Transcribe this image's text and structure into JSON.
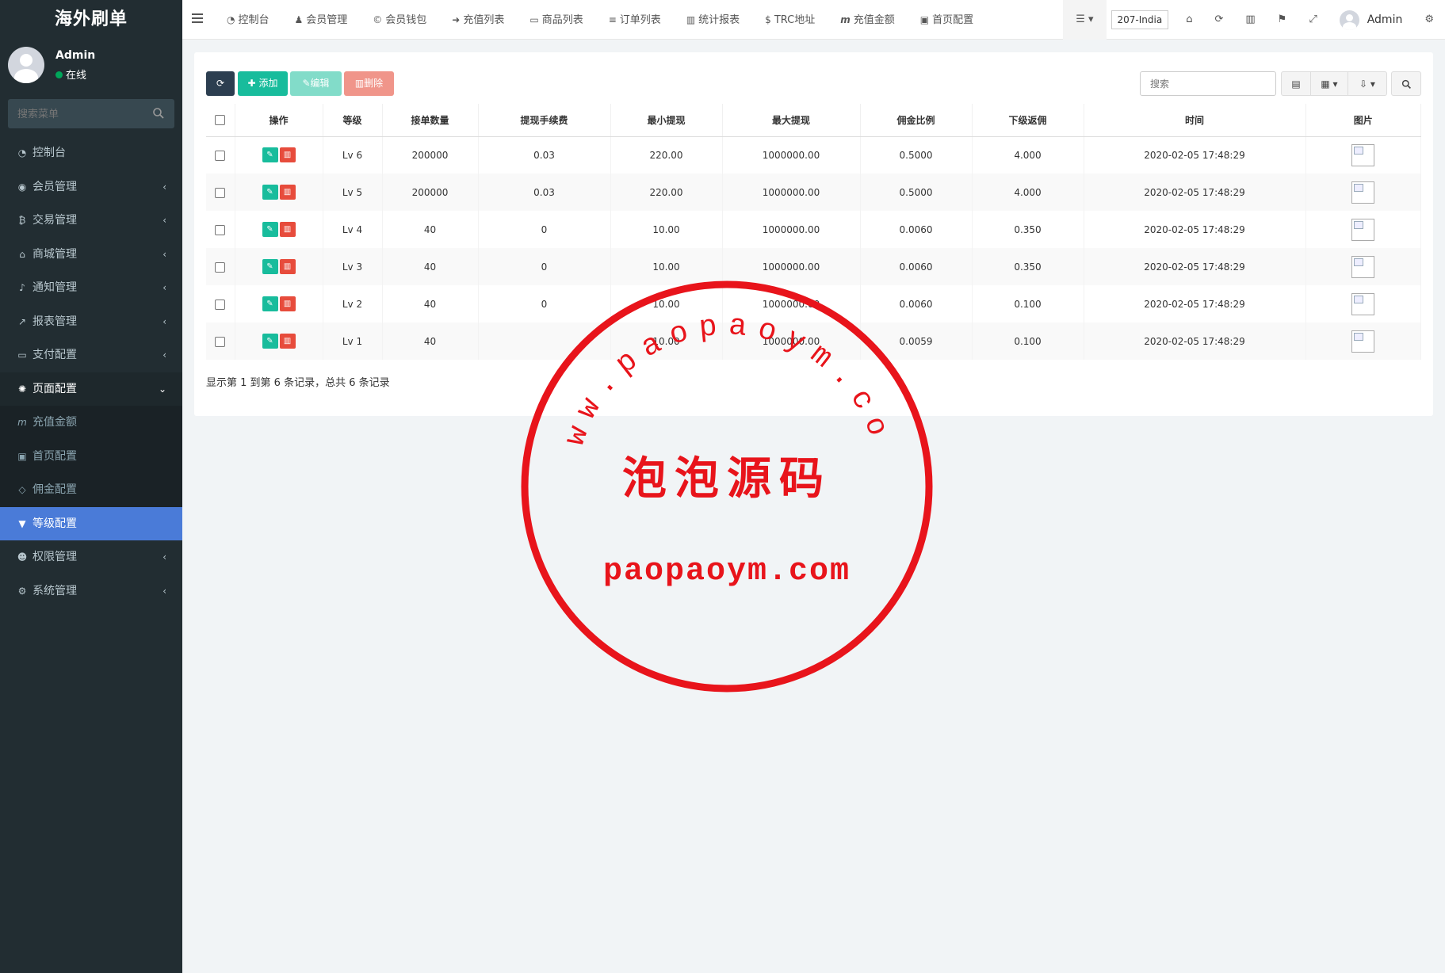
{
  "brand": "海外刷单",
  "user": {
    "name": "Admin",
    "status": "在线"
  },
  "sidebar_search": {
    "placeholder": "搜索菜单"
  },
  "sidebar": {
    "items": [
      {
        "label": "控制台",
        "icon": "dashboard-icon"
      },
      {
        "label": "会员管理",
        "icon": "user-circle-icon"
      },
      {
        "label": "交易管理",
        "icon": "bitcoin-icon"
      },
      {
        "label": "商城管理",
        "icon": "home-icon"
      },
      {
        "label": "通知管理",
        "icon": "bell-icon"
      },
      {
        "label": "报表管理",
        "icon": "line-chart-icon"
      },
      {
        "label": "支付配置",
        "icon": "credit-card-icon"
      },
      {
        "label": "页面配置",
        "icon": "gear-icon"
      },
      {
        "label": "充值金额",
        "icon": "m-icon"
      },
      {
        "label": "首页配置",
        "icon": "save-icon"
      },
      {
        "label": "佣金配置",
        "icon": "diamond-icon"
      },
      {
        "label": "等级配置",
        "icon": "vimeo-icon"
      },
      {
        "label": "权限管理",
        "icon": "group-icon"
      },
      {
        "label": "系统管理",
        "icon": "gears-icon"
      }
    ]
  },
  "topnav": [
    {
      "label": "控制台",
      "icon": "dashboard-icon"
    },
    {
      "label": "会员管理",
      "icon": "user-icon"
    },
    {
      "label": "会员钱包",
      "icon": "cc-icon"
    },
    {
      "label": "充值列表",
      "icon": "sign-in-icon"
    },
    {
      "label": "商品列表",
      "icon": "monitor-icon"
    },
    {
      "label": "订单列表",
      "icon": "list-icon"
    },
    {
      "label": "统计报表",
      "icon": "bar-chart-icon"
    },
    {
      "label": "TRC地址",
      "icon": "dollar-icon"
    },
    {
      "label": "充值金额",
      "icon": "m-icon"
    },
    {
      "label": "首页配置",
      "icon": "save-icon"
    }
  ],
  "topright": {
    "country": "207-India",
    "admin": "Admin"
  },
  "toolbar": {
    "add": "添加",
    "edit": "编辑",
    "delete": "删除",
    "search_placeholder": "搜索"
  },
  "table": {
    "headers": [
      "操作",
      "等级",
      "接单数量",
      "提现手续费",
      "最小提现",
      "最大提现",
      "佣金比例",
      "下级返佣",
      "时间",
      "图片"
    ],
    "rows": [
      {
        "level": "Lv 6",
        "orders": "200000",
        "fee": "0.03",
        "min": "220.00",
        "max": "1000000.00",
        "rate": "0.5000",
        "rebate": "4.000",
        "time": "2020-02-05 17:48:29"
      },
      {
        "level": "Lv 5",
        "orders": "200000",
        "fee": "0.03",
        "min": "220.00",
        "max": "1000000.00",
        "rate": "0.5000",
        "rebate": "4.000",
        "time": "2020-02-05 17:48:29"
      },
      {
        "level": "Lv 4",
        "orders": "40",
        "fee": "0",
        "min": "10.00",
        "max": "1000000.00",
        "rate": "0.0060",
        "rebate": "0.350",
        "time": "2020-02-05 17:48:29"
      },
      {
        "level": "Lv 3",
        "orders": "40",
        "fee": "0",
        "min": "10.00",
        "max": "1000000.00",
        "rate": "0.0060",
        "rebate": "0.350",
        "time": "2020-02-05 17:48:29"
      },
      {
        "level": "Lv 2",
        "orders": "40",
        "fee": "0",
        "min": "10.00",
        "max": "1000000.00",
        "rate": "0.0060",
        "rebate": "0.100",
        "time": "2020-02-05 17:48:29"
      },
      {
        "level": "Lv 1",
        "orders": "40",
        "fee": "",
        "min": "10.00",
        "max": "1000000.00",
        "rate": "0.0059",
        "rebate": "0.100",
        "time": "2020-02-05 17:48:29"
      }
    ]
  },
  "pager": "显示第 1 到第 6 条记录，总共 6 条记录",
  "watermark": {
    "arc_text": "www.paopaoym.com",
    "title": "泡泡源码",
    "domain": "paopaoym.com",
    "color": "#e8141b"
  },
  "colors": {
    "sidebar_bg": "#222d32",
    "active": "#4a7bd8",
    "success": "#18bc9c",
    "danger": "#e74c3c"
  }
}
